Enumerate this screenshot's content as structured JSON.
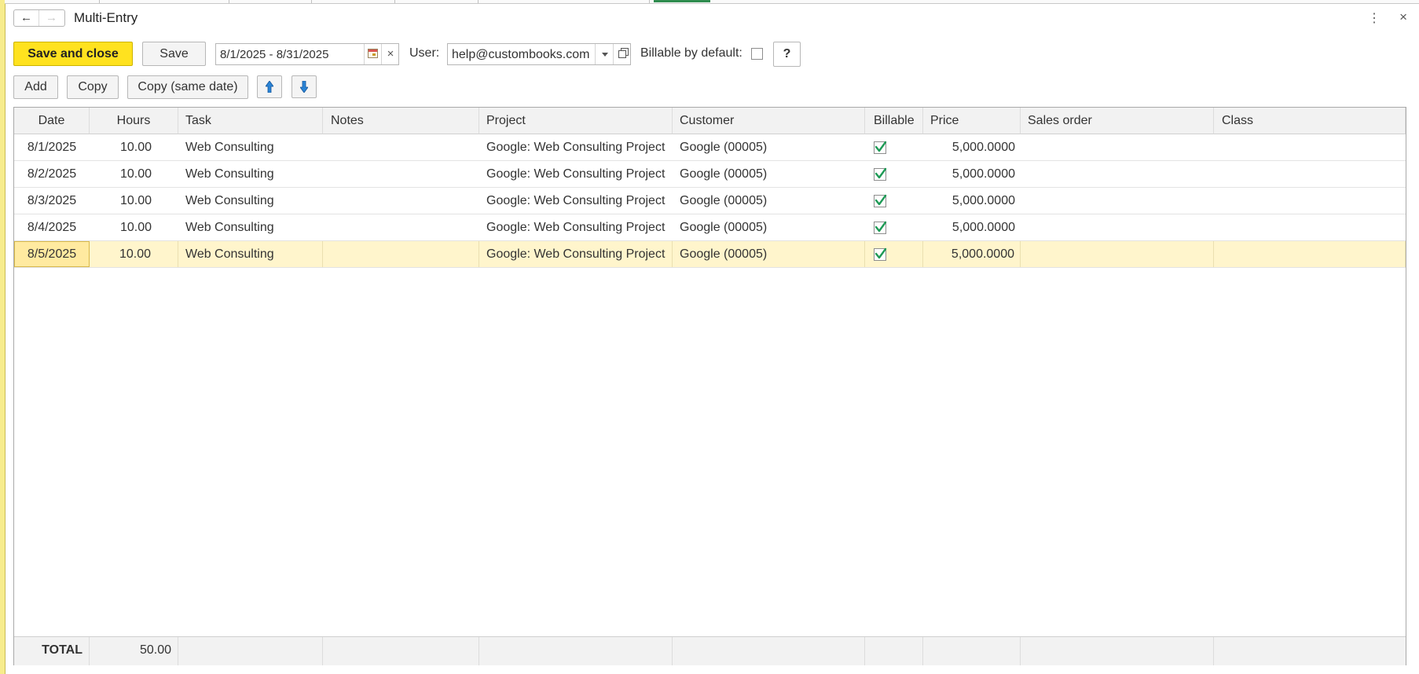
{
  "window": {
    "title": "Multi-Entry",
    "back_glyph": "←",
    "forward_glyph": "→",
    "more_glyph": "⋮",
    "close_glyph": "×"
  },
  "toolbar": {
    "save_close_label": "Save and close",
    "save_label": "Save",
    "period_value": "8/1/2025 - 8/31/2025",
    "clear_glyph": "×",
    "user_label": "User:",
    "user_value": "help@custombooks.com",
    "billable_default_label": "Billable by default:",
    "billable_default_checked": false,
    "help_label": "?"
  },
  "actions": {
    "add_label": "Add",
    "copy_label": "Copy",
    "copy_same_date_label": "Copy (same date)",
    "move_up_icon": "arrow-up-icon",
    "move_down_icon": "arrow-down-icon"
  },
  "colors": {
    "primary": "#ffe21f",
    "check": "#1e9a56",
    "selected_row": "#fff5cc",
    "accent_bar": "#f7ec8c"
  },
  "table": {
    "columns": [
      "Date",
      "Hours",
      "Task",
      "Notes",
      "Project",
      "Customer",
      "Billable",
      "Price",
      "Sales order",
      "Class"
    ],
    "rows": [
      {
        "date": "8/1/2025",
        "hours": "10.00",
        "task": "Web Consulting",
        "notes": "",
        "project": "Google: Web Consulting Project",
        "customer": "Google (00005)",
        "billable": true,
        "price": "5,000.0000",
        "sales_order": "",
        "class": ""
      },
      {
        "date": "8/2/2025",
        "hours": "10.00",
        "task": "Web Consulting",
        "notes": "",
        "project": "Google: Web Consulting Project",
        "customer": "Google (00005)",
        "billable": true,
        "price": "5,000.0000",
        "sales_order": "",
        "class": ""
      },
      {
        "date": "8/3/2025",
        "hours": "10.00",
        "task": "Web Consulting",
        "notes": "",
        "project": "Google: Web Consulting Project",
        "customer": "Google (00005)",
        "billable": true,
        "price": "5,000.0000",
        "sales_order": "",
        "class": ""
      },
      {
        "date": "8/4/2025",
        "hours": "10.00",
        "task": "Web Consulting",
        "notes": "",
        "project": "Google: Web Consulting Project",
        "customer": "Google (00005)",
        "billable": true,
        "price": "5,000.0000",
        "sales_order": "",
        "class": ""
      },
      {
        "date": "8/5/2025",
        "hours": "10.00",
        "task": "Web Consulting",
        "notes": "",
        "project": "Google: Web Consulting Project",
        "customer": "Google (00005)",
        "billable": true,
        "price": "5,000.0000",
        "sales_order": "",
        "class": ""
      }
    ],
    "selected_row": 4,
    "total_label": "TOTAL",
    "total_hours": "50.00"
  }
}
